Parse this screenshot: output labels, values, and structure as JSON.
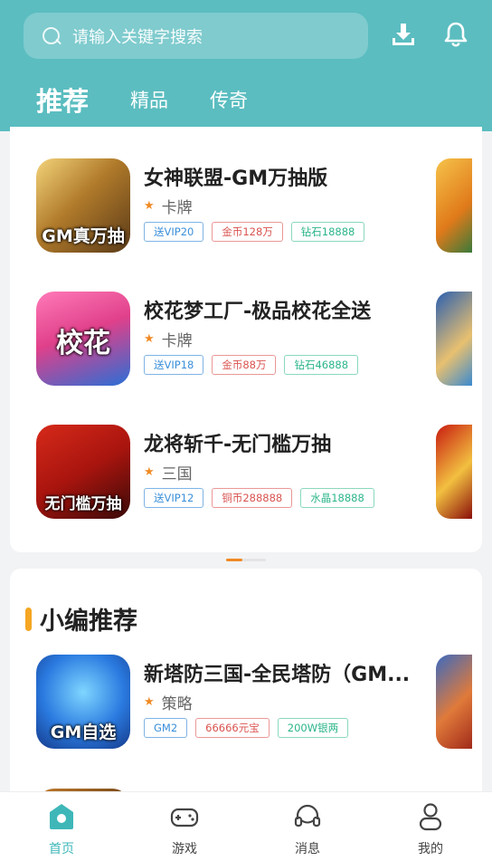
{
  "search": {
    "placeholder": "请输入关键字搜索",
    "icon": "search-icon"
  },
  "header_icons": [
    "download-icon",
    "bell-icon"
  ],
  "tabs": [
    {
      "label": "推荐",
      "active": true
    },
    {
      "label": "精品",
      "active": false
    },
    {
      "label": "传奇",
      "active": false
    }
  ],
  "section1": {
    "games": [
      {
        "title": "女神联盟-GM万抽版",
        "category": "卡牌",
        "icon_text": "GM真万抽",
        "tags": [
          {
            "text": "送VIP20",
            "color": "blue"
          },
          {
            "text": "金币128万",
            "color": "red"
          },
          {
            "text": "钻石18888",
            "color": "green"
          }
        ]
      },
      {
        "title": "校花梦工厂-极品校花全送",
        "category": "卡牌",
        "icon_text": "校花",
        "tags": [
          {
            "text": "送VIP18",
            "color": "blue"
          },
          {
            "text": "金币88万",
            "color": "red"
          },
          {
            "text": "钻石46888",
            "color": "green"
          }
        ]
      },
      {
        "title": "龙将斩千-无门槛万抽",
        "category": "三国",
        "icon_text": "无门槛万抽",
        "tags": [
          {
            "text": "送VIP12",
            "color": "blue"
          },
          {
            "text": "铜币288888",
            "color": "red"
          },
          {
            "text": "水晶18888",
            "color": "green"
          }
        ]
      }
    ]
  },
  "section2": {
    "title": "小编推荐",
    "games": [
      {
        "title": "新塔防三国-全民塔防（GM...",
        "category": "策略",
        "icon_text": "GM自选",
        "tags": [
          {
            "text": "GM2",
            "color": "blue"
          },
          {
            "text": "66666元宝",
            "color": "red"
          },
          {
            "text": "200W银两",
            "color": "green"
          }
        ]
      }
    ]
  },
  "tabbar": [
    {
      "label": "首页",
      "icon": "home-icon",
      "active": true
    },
    {
      "label": "游戏",
      "icon": "gamepad-icon",
      "active": false
    },
    {
      "label": "消息",
      "icon": "headset-icon",
      "active": false
    },
    {
      "label": "我的",
      "icon": "user-icon",
      "active": false
    }
  ],
  "colors": {
    "header": "#5bbdc0",
    "accent": "#3fb7b8",
    "star": "#f08a24",
    "section_bar": "#f5a623"
  }
}
